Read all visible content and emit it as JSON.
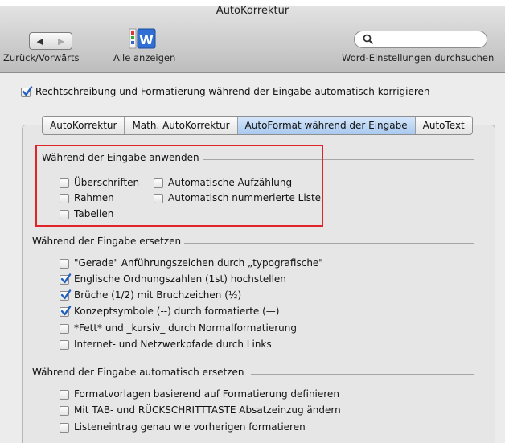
{
  "window": {
    "title": "AutoKorrektur"
  },
  "toolbar": {
    "back_forward_label": "Zurück/Vorwärts",
    "show_all_label": "Alle anzeigen",
    "search_label": "Word-Einstellungen durchsuchen",
    "search_value": ""
  },
  "main_option": {
    "label": "Rechtschreibung und Formatierung während der Eingabe automatisch korrigieren",
    "checked": true
  },
  "tabs": [
    {
      "label": "AutoKorrektur",
      "active": false
    },
    {
      "label": "Math. AutoKorrektur",
      "active": false
    },
    {
      "label": "AutoFormat während der Eingabe",
      "active": true
    },
    {
      "label": "AutoText",
      "active": false
    }
  ],
  "sections": {
    "apply": {
      "title": "Während der Eingabe anwenden",
      "left": [
        {
          "label": "Überschriften",
          "checked": false
        },
        {
          "label": "Rahmen",
          "checked": false
        },
        {
          "label": "Tabellen",
          "checked": false
        }
      ],
      "right": [
        {
          "label": "Automatische Aufzählung",
          "checked": false
        },
        {
          "label": "Automatisch nummerierte Liste",
          "checked": false
        }
      ]
    },
    "replace": {
      "title": "Während der Eingabe ersetzen",
      "items": [
        {
          "label": "\"Gerade\" Anführungszeichen durch „typografische\"",
          "checked": false
        },
        {
          "label": "Englische Ordnungszahlen (1st) hochstellen",
          "checked": true
        },
        {
          "label": "Brüche (1/2) mit Bruchzeichen (½)",
          "checked": true
        },
        {
          "label": "Konzeptsymbole (--) durch formatierte (—)",
          "checked": true
        },
        {
          "label": "*Fett* und _kursiv_ durch Normalformatierung",
          "checked": false
        },
        {
          "label": "Internet- und Netzwerkpfade durch Links",
          "checked": false
        }
      ]
    },
    "auto": {
      "title": "Während der Eingabe automatisch ersetzen",
      "items": [
        {
          "label": "Formatvorlagen basierend auf Formatierung definieren",
          "checked": false
        },
        {
          "label": "Mit TAB- und RÜCKSCHRITTTASTE Absatzeinzug ändern",
          "checked": false
        },
        {
          "label": "Listeneintrag genau wie vorherigen formatieren",
          "checked": false
        }
      ]
    }
  },
  "colors": {
    "highlight_border": "#e0242a",
    "active_tab": "#a9c9ef",
    "checkmark": "#1f5fbf"
  }
}
